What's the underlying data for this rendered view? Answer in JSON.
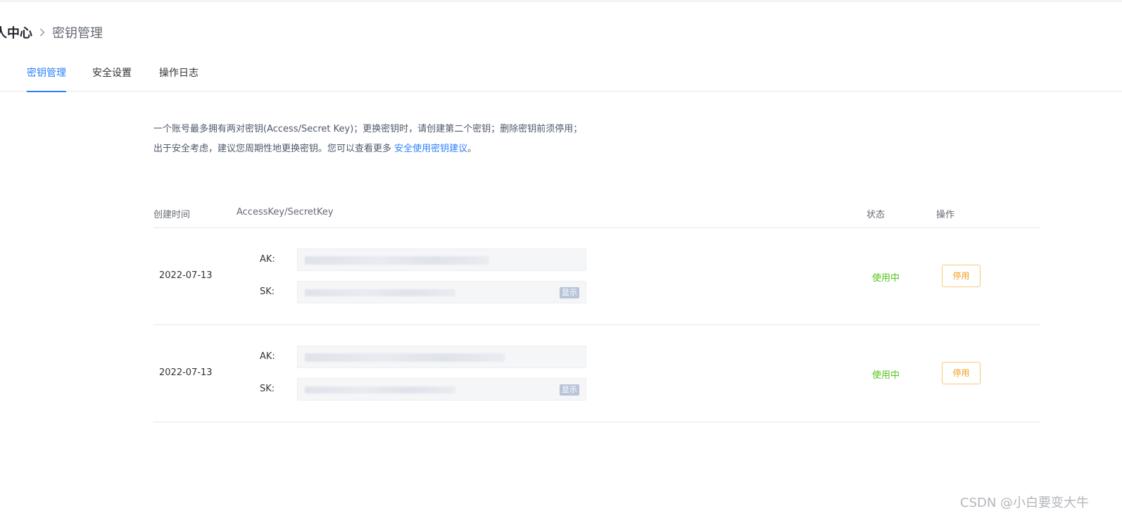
{
  "breadcrumb": {
    "root": "人中心",
    "current": "密钥管理"
  },
  "tabs": [
    {
      "label": "密钥管理",
      "active": true
    },
    {
      "label": "安全设置",
      "active": false
    },
    {
      "label": "操作日志",
      "active": false
    }
  ],
  "notice": {
    "text": "一个账号最多拥有两对密钥(Access/Secret Key)；更换密钥时，请创建第二个密钥；删除密钥前须停用；出于安全考虑，建议您周期性地更换密钥。您可以查看更多 ",
    "link": "安全使用密钥建议",
    "end": "。"
  },
  "table": {
    "headers": {
      "date": "创建时间",
      "keys": "AccessKey/SecretKey",
      "status": "状态",
      "op": "操作"
    },
    "ak_label": "AK:",
    "sk_label": "SK:",
    "show_label": "显示",
    "rows": [
      {
        "date": "2022-07-13",
        "status": "使用中",
        "action": "停用"
      },
      {
        "date": "2022-07-13",
        "status": "使用中",
        "action": "停用"
      }
    ]
  },
  "watermark": "CSDN @小白要变大牛",
  "colors": {
    "accent": "#2d7ff9",
    "status_active": "#52c41a",
    "warning": "#f0a020"
  }
}
